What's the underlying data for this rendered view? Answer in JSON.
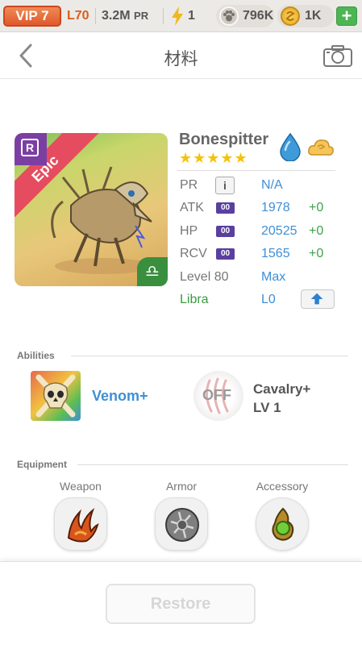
{
  "status_bar": {
    "vip_label": "VIP 7",
    "level": "L70",
    "power": "3.2M",
    "power_unit": "PR",
    "energy": "1",
    "paw_currency": "796K",
    "gold_currency": "1K",
    "add_button": "+"
  },
  "header": {
    "title": "材料"
  },
  "hero": {
    "rarity_badge": "R",
    "rarity": "Epic",
    "sign_symbol": "♎",
    "name": "Bonespitter",
    "stars": "★★★★★",
    "element_icon": "water-drop-icon",
    "type_icon": "cloud-icon"
  },
  "stats": {
    "pr": {
      "label": "PR",
      "value": "N/A"
    },
    "atk": {
      "label": "ATK",
      "badge": "00",
      "value": "1978",
      "bonus": "+0"
    },
    "hp": {
      "label": "HP",
      "badge": "00",
      "value": "20525",
      "bonus": "+0"
    },
    "rcv": {
      "label": "RCV",
      "badge": "00",
      "value": "1565",
      "bonus": "+0"
    },
    "level": {
      "label": "Level 80",
      "value": "Max"
    },
    "sign": {
      "label": "Libra",
      "value": "L0"
    }
  },
  "abilities": {
    "section_title": "Abilities",
    "primary": {
      "label": "Venom+"
    },
    "secondary": {
      "state": "OFF",
      "name_line1": "Cavalry+",
      "name_line2": "LV 1"
    }
  },
  "equipment": {
    "section_title": "Equipment",
    "slots": [
      {
        "label": "Weapon"
      },
      {
        "label": "Armor"
      },
      {
        "label": "Accessory"
      }
    ]
  },
  "footer": {
    "restore_label": "Restore"
  },
  "colors": {
    "accent_blue": "#3f8fd6",
    "bonus_green": "#3ea24a",
    "epic_red": "#e64c5f",
    "vip_orange": "#e0592c"
  }
}
